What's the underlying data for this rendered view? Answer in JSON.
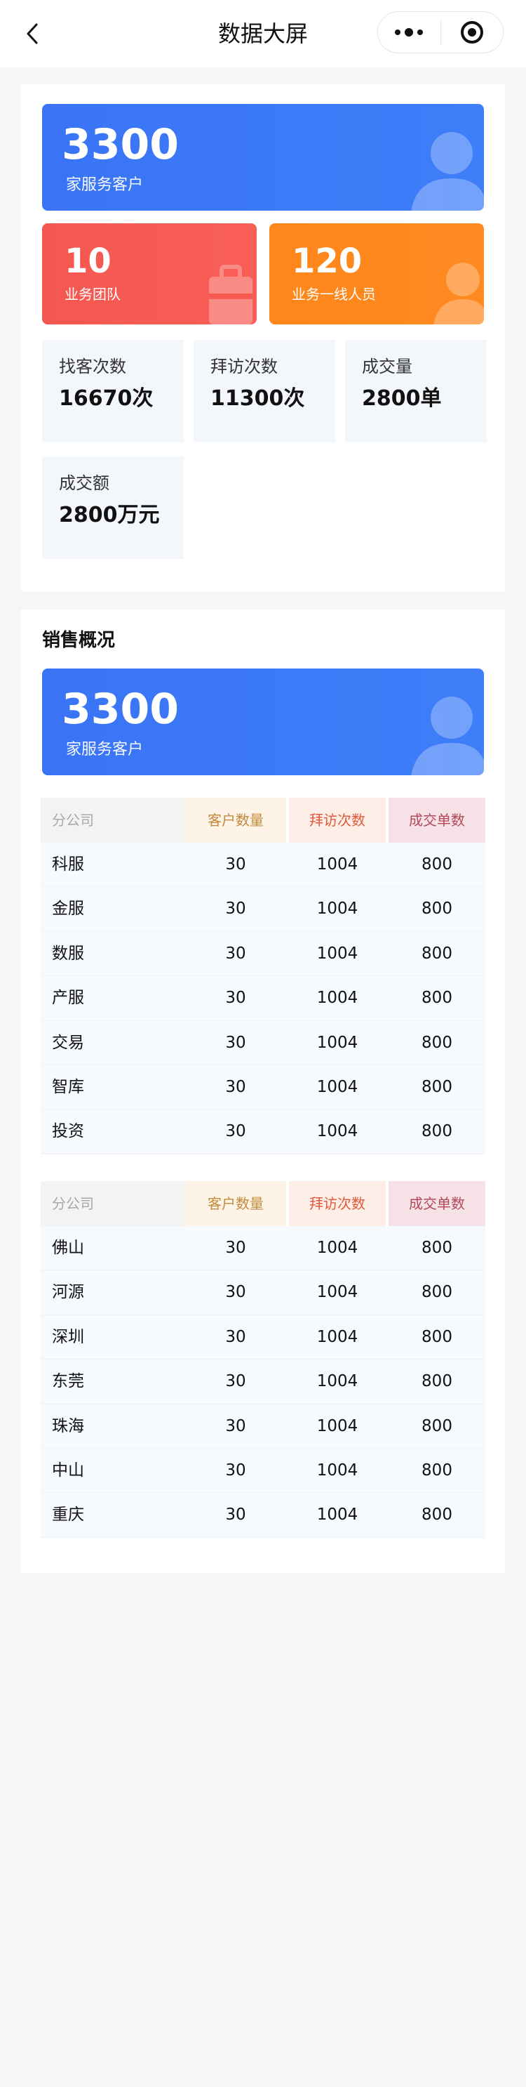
{
  "header": {
    "title": "数据大屏",
    "back_icon": "chevron-left-icon",
    "menu_icon": "more-dots-icon",
    "close_icon": "target-circle-icon"
  },
  "overview": {
    "banner": {
      "value": "3300",
      "caption": "家服务客户"
    },
    "teams": {
      "value": "10",
      "caption": "业务团队"
    },
    "staff": {
      "value": "120",
      "caption": "业务一线人员"
    },
    "stats": [
      {
        "label": "找客次数",
        "value": "16670次"
      },
      {
        "label": "拜访次数",
        "value": "11300次"
      },
      {
        "label": "成交量",
        "value": "2800单"
      },
      {
        "label": "成交额",
        "value": "2800万元"
      }
    ]
  },
  "sales": {
    "title": "销售概况",
    "banner": {
      "value": "3300",
      "caption": "家服务客户"
    },
    "columns": [
      "分公司",
      "客户数量",
      "拜访次数",
      "成交单数"
    ],
    "table1": [
      [
        "科服",
        "30",
        "1004",
        "800"
      ],
      [
        "金服",
        "30",
        "1004",
        "800"
      ],
      [
        "数服",
        "30",
        "1004",
        "800"
      ],
      [
        "产服",
        "30",
        "1004",
        "800"
      ],
      [
        "交易",
        "30",
        "1004",
        "800"
      ],
      [
        "智库",
        "30",
        "1004",
        "800"
      ],
      [
        "投资",
        "30",
        "1004",
        "800"
      ]
    ],
    "table2": [
      [
        "佛山",
        "30",
        "1004",
        "800"
      ],
      [
        "河源",
        "30",
        "1004",
        "800"
      ],
      [
        "深圳",
        "30",
        "1004",
        "800"
      ],
      [
        "东莞",
        "30",
        "1004",
        "800"
      ],
      [
        "珠海",
        "30",
        "1004",
        "800"
      ],
      [
        "中山",
        "30",
        "1004",
        "800"
      ],
      [
        "重庆",
        "30",
        "1004",
        "800"
      ]
    ]
  },
  "colors": {
    "blue": "#3a74f5",
    "red": "#f4574f",
    "orange": "#ff8619",
    "page_bg": "#f5f6f8"
  }
}
